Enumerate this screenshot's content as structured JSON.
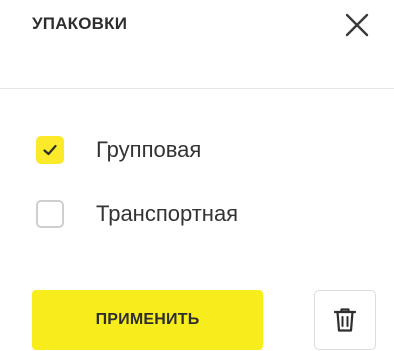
{
  "header": {
    "title": "УПАКОВКИ",
    "close_icon": "close-icon"
  },
  "options": [
    {
      "label": "Групповая",
      "checked": true
    },
    {
      "label": "Транспортная",
      "checked": false
    }
  ],
  "actions": {
    "apply_label": "ПРИМЕНИТЬ",
    "delete_icon": "trash-icon"
  },
  "colors": {
    "accent": "#f7ec1c",
    "checkbox_checked": "#fbea2a",
    "text": "#2e2e2e",
    "border": "#dcdcdc"
  }
}
